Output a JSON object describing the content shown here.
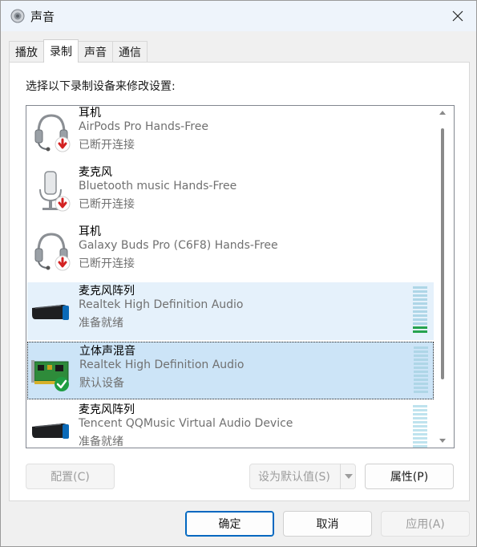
{
  "window": {
    "title": "声音"
  },
  "tabs": [
    {
      "label": "播放"
    },
    {
      "label": "录制"
    },
    {
      "label": "声音"
    },
    {
      "label": "通信"
    }
  ],
  "panel": {
    "instruction": "选择以下录制设备来修改设置:"
  },
  "devices": [
    {
      "name": "耳机",
      "desc": "AirPods Pro Hands-Free",
      "status": "已断开连接",
      "icon": "headset-icon",
      "badge": "disconnected-badge-icon"
    },
    {
      "name": "麦克风",
      "desc": "Bluetooth music Hands-Free",
      "status": "已断开连接",
      "icon": "microphone-icon",
      "badge": "disconnected-badge-icon"
    },
    {
      "name": "耳机",
      "desc": "Galaxy Buds Pro (C6F8) Hands-Free",
      "status": "已断开连接",
      "icon": "headset-icon",
      "badge": "disconnected-badge-icon"
    },
    {
      "name": "麦克风阵列",
      "desc": "Realtek High Definition Audio",
      "status": "准备就绪",
      "icon": "mic-array-icon",
      "level": 0.15
    },
    {
      "name": "立体声混音",
      "desc": "Realtek High Definition Audio",
      "status": "默认设备",
      "icon": "sound-card-icon",
      "badge": "default-check-icon",
      "level": 0
    },
    {
      "name": "麦克风阵列",
      "desc": "Tencent QQMusic Virtual Audio Device",
      "status": "准备就绪",
      "icon": "mic-array-icon",
      "level": 0
    }
  ],
  "buttons": {
    "configure": "配置(C)",
    "set_default": "设为默认值(S)",
    "properties": "属性(P)",
    "ok": "确定",
    "cancel": "取消",
    "apply": "应用(A)"
  },
  "colors": {
    "selected_bg": "#cce4f7",
    "hover_bg": "#e5f1fb",
    "level_active": "#26a34f",
    "accent": "#0067c0"
  }
}
